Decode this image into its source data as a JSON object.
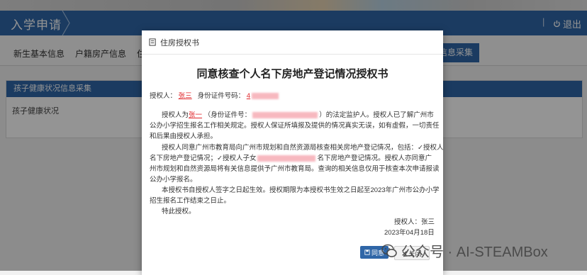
{
  "header": {
    "title": "入学申请",
    "separator": "|",
    "logout_label": "退出"
  },
  "tabs": [
    "新生基本信息",
    "户籍房产信息",
    "住",
    "信息采集"
  ],
  "panel": {
    "title": "孩子健康状况信息采集",
    "row_label": "孩子健康状况"
  },
  "modal": {
    "header_title": "住房授权书",
    "doc_title": "同意核查个人名下房地产登记情况授权书",
    "authorizer_label": "授权人：",
    "authorizer_name": "张三",
    "id_label": "身份证件号码：",
    "id_value_visible": "4",
    "p1_a": "授权人为",
    "p1_name": "张一",
    "p1_b": "（身份证件号：",
    "p1_c": "）的法定监护人。授权人已了解广州市",
    "p1_l2": "公办小学招生报名工作相关规定。授权人保证所填报及提供的情况真实无误，如有虚假，一切责任",
    "p1_l3": "和后果由授权人承担。",
    "p2_l1": "授权人同意广州市教育局向广州市规划和自然资源局核查相关房地产登记情况，包括：✓授权人",
    "p2_l2a": "名下房地产登记情况；✓授权人子女",
    "p2_l2b": "名下房地产登记情况。授权人亦同意广",
    "p2_l3": "州市规划和自然资源局将有关信息提供予广州市教育局。查询的相关信息仅用于核查本次申请报读",
    "p2_l4": "公办小学报名。",
    "p3_l1": "本授权书自授权人签字之日起生效。授权期限为本授权书生效之日起至2023年广州市公办小学",
    "p3_l2": "招生报名工作结束之日止。",
    "p4": "特此授权。",
    "sign_line": "授权人：张三",
    "date_line": "2023年04月18日",
    "agree_label": "同意",
    "close_label": "关闭"
  },
  "watermark": "公众号 · AI-STEAMBox",
  "icons": [
    "power-icon",
    "document-icon",
    "save-icon",
    "close-icon",
    "wechat-icon"
  ],
  "colors": {
    "primary": "#2f66a7",
    "highlight": "#e0262a"
  }
}
